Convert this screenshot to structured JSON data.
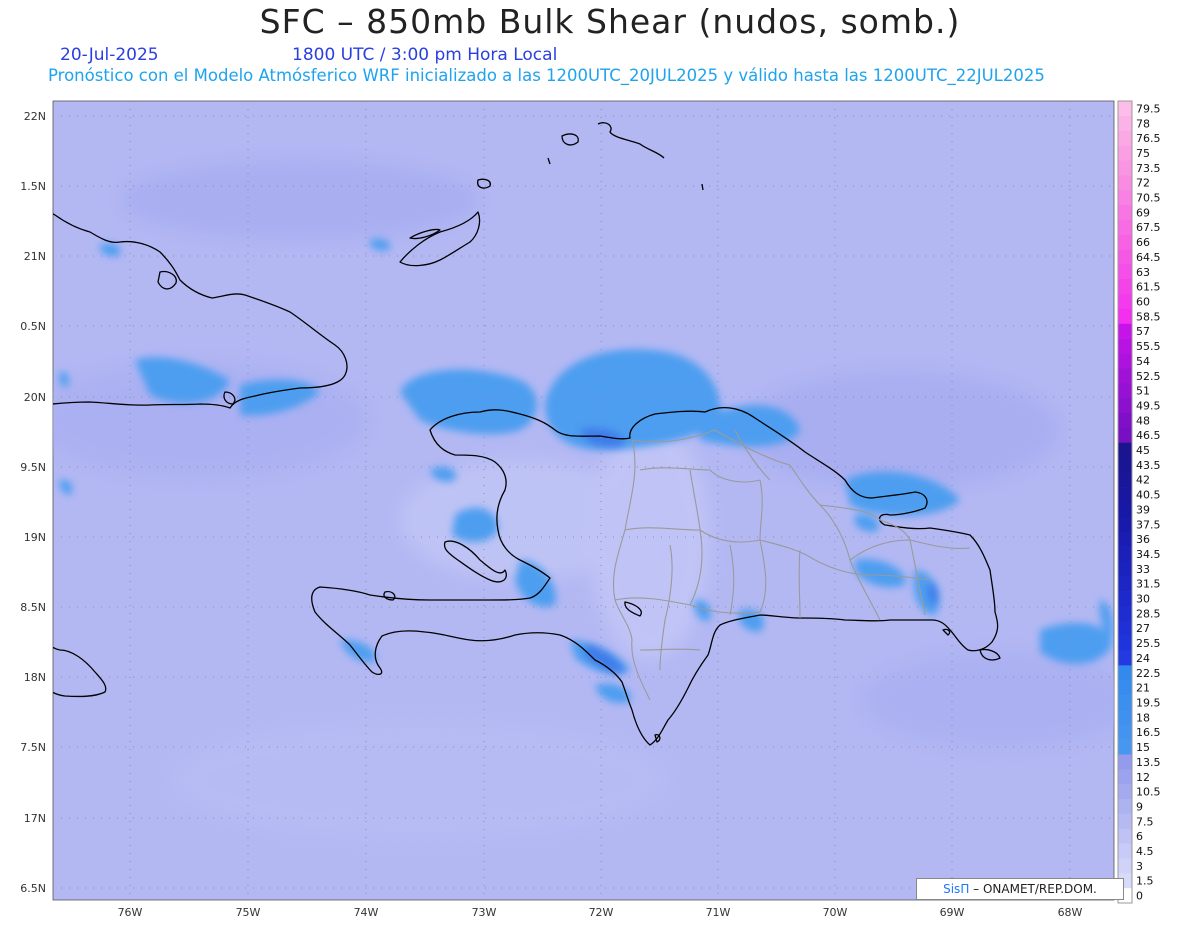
{
  "header": {
    "title": "SFC – 850mb Bulk Shear (nudos, somb.)",
    "date": "20-Jul-2025",
    "time": "1800 UTC / 3:00 pm Hora Local",
    "subtitle": "Pronóstico con el Modelo Atmósferico WRF inicializado a las 1200UTC_20JUL2025 y válido hasta las  1200UTC_22JUL2025"
  },
  "axes": {
    "lat_labels": [
      "22N",
      "1.5N",
      "21N",
      "0.5N",
      "20N",
      "9.5N",
      "19N",
      "8.5N",
      "18N",
      "7.5N",
      "17N",
      "6.5N"
    ],
    "lon_labels": [
      "76W",
      "75W",
      "74W",
      "73W",
      "72W",
      "71W",
      "70W",
      "69W",
      "68W"
    ]
  },
  "colorbar": {
    "labels": [
      "79.5",
      "78",
      "76.5",
      "75",
      "73.5",
      "72",
      "70.5",
      "69",
      "67.5",
      "66",
      "64.5",
      "63",
      "61.5",
      "60",
      "58.5",
      "57",
      "55.5",
      "54",
      "52.5",
      "51",
      "49.5",
      "48",
      "46.5",
      "45",
      "43.5",
      "42",
      "40.5",
      "39",
      "37.5",
      "36",
      "34.5",
      "33",
      "31.5",
      "30",
      "28.5",
      "27",
      "25.5",
      "24",
      "22.5",
      "21",
      "19.5",
      "18",
      "16.5",
      "15",
      "13.5",
      "12",
      "10.5",
      "9",
      "7.5",
      "6",
      "4.5",
      "3",
      "1.5",
      "0"
    ]
  },
  "credit": {
    "brand": "SisΠ",
    "text": " – ONAMET/REP.DOM."
  },
  "colors": {
    "background_field": "#b3b8f3",
    "strong_shear": "#3c95ee",
    "coastline": "#000000",
    "provinces": "#9a9a9a"
  }
}
